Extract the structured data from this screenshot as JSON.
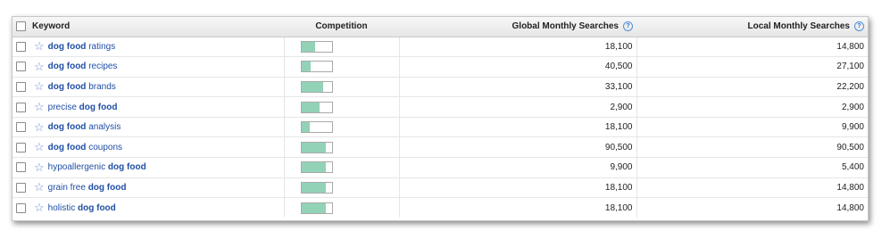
{
  "header": {
    "keyword": "Keyword",
    "competition": "Competition",
    "global": "Global Monthly Searches",
    "local": "Local Monthly Searches",
    "help_glyph": "?"
  },
  "star_glyph": "☆",
  "rows": [
    {
      "parts": [
        {
          "t": "dog food",
          "b": true
        },
        {
          "t": " ratings",
          "b": false
        }
      ],
      "competition": 0.45,
      "global": "18,100",
      "local": "14,800"
    },
    {
      "parts": [
        {
          "t": "dog food",
          "b": true
        },
        {
          "t": " recipes",
          "b": false
        }
      ],
      "competition": 0.32,
      "global": "40,500",
      "local": "27,100"
    },
    {
      "parts": [
        {
          "t": "dog food",
          "b": true
        },
        {
          "t": " brands",
          "b": false
        }
      ],
      "competition": 0.72,
      "global": "33,100",
      "local": "22,200"
    },
    {
      "parts": [
        {
          "t": "precise ",
          "b": false
        },
        {
          "t": "dog food",
          "b": true
        }
      ],
      "competition": 0.6,
      "global": "2,900",
      "local": "2,900"
    },
    {
      "parts": [
        {
          "t": "dog food",
          "b": true
        },
        {
          "t": " analysis",
          "b": false
        }
      ],
      "competition": 0.27,
      "global": "18,100",
      "local": "9,900"
    },
    {
      "parts": [
        {
          "t": "dog food",
          "b": true
        },
        {
          "t": " coupons",
          "b": false
        }
      ],
      "competition": 0.8,
      "global": "90,500",
      "local": "90,500"
    },
    {
      "parts": [
        {
          "t": "hypoallergenic ",
          "b": false
        },
        {
          "t": "dog food",
          "b": true
        }
      ],
      "competition": 0.82,
      "global": "9,900",
      "local": "5,400"
    },
    {
      "parts": [
        {
          "t": "grain free ",
          "b": false
        },
        {
          "t": "dog food",
          "b": true
        }
      ],
      "competition": 0.82,
      "global": "18,100",
      "local": "14,800"
    },
    {
      "parts": [
        {
          "t": "holistic ",
          "b": false
        },
        {
          "t": "dog food",
          "b": true
        }
      ],
      "competition": 0.8,
      "global": "18,100",
      "local": "14,800"
    }
  ],
  "colors": {
    "link": "#1f4fa5",
    "bar_fill": "#92d3b7",
    "star": "#6f8fd6"
  }
}
